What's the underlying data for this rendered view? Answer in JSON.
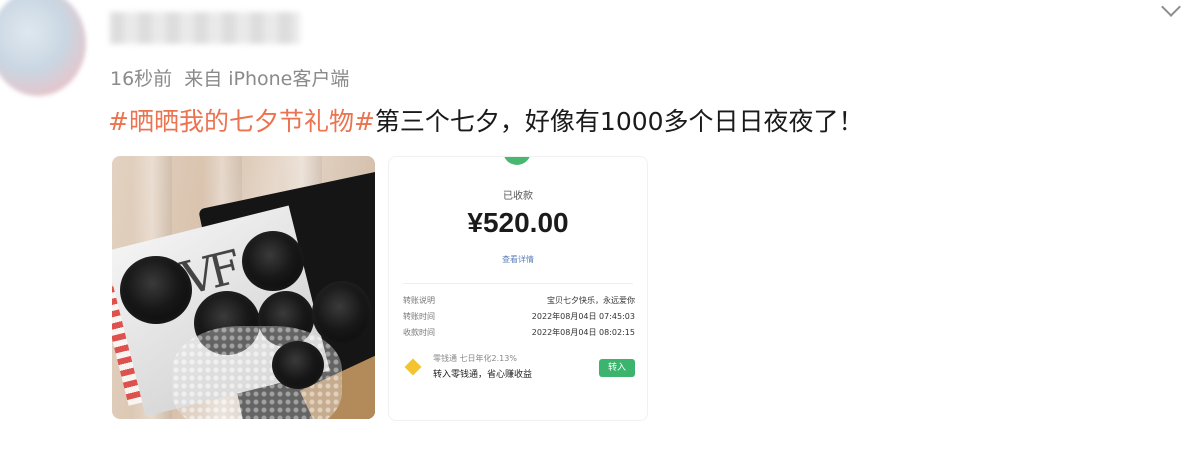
{
  "post": {
    "meta": {
      "time": "16秒前",
      "source": "来自 iPhone客户端"
    },
    "content": {
      "hashtag": "#晒晒我的七夕节礼物#",
      "text": "第三个七夕，好像有1000多个日日夜夜了！"
    },
    "images": {
      "photo_text": "VF",
      "receipt": {
        "status": "已收款",
        "amount": "¥520.00",
        "detail_link": "查看详情",
        "rows": [
          {
            "key": "转账说明",
            "value": "宝贝七夕快乐，永远爱你"
          },
          {
            "key": "转账时间",
            "value": "2022年08月04日 07:45:03"
          },
          {
            "key": "收款时间",
            "value": "2022年08月04日 08:02:15"
          }
        ],
        "fund_line1": "零钱通 七日年化2.13%",
        "fund_line2": "转入零钱通，省心赚收益",
        "transfer_button": "转入"
      }
    }
  }
}
